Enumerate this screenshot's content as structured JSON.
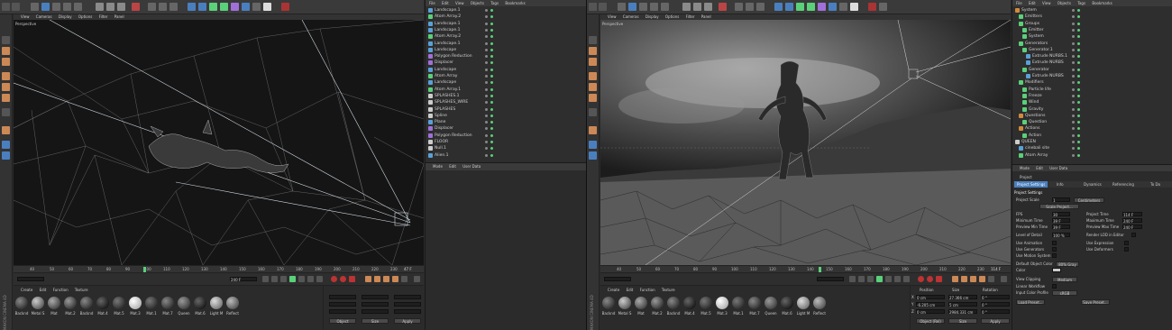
{
  "left": {
    "viewport_menu": [
      "View",
      "Cameras",
      "Display",
      "Options",
      "Filter",
      "Panel"
    ],
    "viewport_label": "Perspective",
    "timeline_ticks": [
      "40",
      "50",
      "60",
      "70",
      "80",
      "90",
      "100",
      "110",
      "120",
      "130",
      "140",
      "150",
      "160",
      "170",
      "180",
      "190",
      "200",
      "210",
      "220",
      "230"
    ],
    "frame_display": "47 F",
    "end_frame": "240 F",
    "mat_menu": [
      "Create",
      "Edit",
      "Function",
      "Texture"
    ],
    "materials": [
      "Backnd",
      "Metal S",
      "Mat",
      "Mat.2",
      "Backnd",
      "Mat.4",
      "Mat.5",
      "Mat.3",
      "Mat.1",
      "Mat.7",
      "Queen",
      "Mat.6",
      "Light M",
      "Reflect"
    ],
    "coord_buttons": [
      "Object",
      "Size",
      "Apply"
    ],
    "objects": [
      {
        "name": "Landscape.1",
        "color": "#5aa0d8"
      },
      {
        "name": "Atom Array.2",
        "color": "#5ad07a"
      },
      {
        "name": "Landscape.1",
        "color": "#5aa0d8"
      },
      {
        "name": "Landscape.1",
        "color": "#5aa0d8"
      },
      {
        "name": "Atom Array.2",
        "color": "#5ad07a"
      },
      {
        "name": "Landscape.1",
        "color": "#5aa0d8"
      },
      {
        "name": "Landscape",
        "color": "#5aa0d8"
      },
      {
        "name": "Polygon Reduction",
        "color": "#a070d8"
      },
      {
        "name": "Displacer",
        "color": "#a070d8"
      },
      {
        "name": "Landscape",
        "color": "#5aa0d8"
      },
      {
        "name": "Atom Array",
        "color": "#5ad07a"
      },
      {
        "name": "Landscape",
        "color": "#5aa0d8"
      },
      {
        "name": "Atom Array.1",
        "color": "#5ad07a"
      },
      {
        "name": "SPLASHES.1",
        "color": "#cccccc"
      },
      {
        "name": "SPLASHES_WIRE",
        "color": "#cccccc"
      },
      {
        "name": "SPLASHES",
        "color": "#cccccc"
      },
      {
        "name": "Spline",
        "color": "#cccccc"
      },
      {
        "name": "Plane",
        "color": "#5aa0d8"
      },
      {
        "name": "Displacer",
        "color": "#a070d8"
      },
      {
        "name": "Polygon Reduction",
        "color": "#a070d8"
      },
      {
        "name": "FLOOR",
        "color": "#cccccc"
      },
      {
        "name": "Null.1",
        "color": "#cccccc"
      },
      {
        "name": "Alien.1",
        "color": "#5aa0d8"
      }
    ],
    "om_menu": [
      "File",
      "Edit",
      "View",
      "Objects",
      "Tags",
      "Bookmarks"
    ],
    "attr_menu": [
      "Mode",
      "Edit",
      "User Data"
    ]
  },
  "right": {
    "viewport_menu": [
      "View",
      "Cameras",
      "Display",
      "Options",
      "Filter",
      "Panel"
    ],
    "viewport_label": "Perspective",
    "timeline_ticks": [
      "40",
      "50",
      "60",
      "70",
      "80",
      "90",
      "100",
      "110",
      "120",
      "130",
      "140",
      "150",
      "160",
      "170",
      "180",
      "190",
      "200",
      "210",
      "220",
      "230"
    ],
    "frame_display": "114 F",
    "mat_menu": [
      "Create",
      "Edit",
      "Function",
      "Texture"
    ],
    "materials": [
      "Backnd",
      "Metal S",
      "Mat",
      "Mat.2",
      "Backnd",
      "Mat.4",
      "Mat.5",
      "Mat.3",
      "Mat.1",
      "Mat.7",
      "Queen",
      "Mat.6",
      "Light M",
      "Reflect"
    ],
    "coord_headers": [
      "Position",
      "Size",
      "Rotation"
    ],
    "coords": [
      {
        "axis": "X",
        "pos": "0 cm",
        "size": "27.366 cm",
        "rot": "0 °"
      },
      {
        "axis": "Y",
        "pos": "-6.205 cm",
        "size": "5 cm",
        "rot": "0 °"
      },
      {
        "axis": "Z",
        "pos": "0 cm",
        "size": "2984.331 cm",
        "rot": "0 °"
      }
    ],
    "coord_buttons": [
      "Object (Rel)",
      "Size",
      "Apply"
    ],
    "om_menu": [
      "File",
      "Edit",
      "View",
      "Objects",
      "Tags",
      "Bookmarks"
    ],
    "objects": [
      {
        "name": "System",
        "color": "#d08a3a",
        "indent": 0
      },
      {
        "name": "Emitters",
        "color": "#5ad07a",
        "indent": 1
      },
      {
        "name": "Groups",
        "color": "#5ad07a",
        "indent": 1
      },
      {
        "name": "Emitter",
        "color": "#5ad07a",
        "indent": 2
      },
      {
        "name": "System",
        "color": "#5ad07a",
        "indent": 2
      },
      {
        "name": "Generators",
        "color": "#5ad07a",
        "indent": 1
      },
      {
        "name": "Generator.1",
        "color": "#5ad07a",
        "indent": 2
      },
      {
        "name": "Extrude NURBS.1",
        "color": "#5aa0d8",
        "indent": 3
      },
      {
        "name": "Extrude NURBS",
        "color": "#5aa0d8",
        "indent": 3
      },
      {
        "name": "Generator",
        "color": "#5ad07a",
        "indent": 2
      },
      {
        "name": "Extrude NURBS",
        "color": "#5aa0d8",
        "indent": 3
      },
      {
        "name": "Modifiers",
        "color": "#5ad07a",
        "indent": 1
      },
      {
        "name": "Particle life",
        "color": "#5ad07a",
        "indent": 2
      },
      {
        "name": "Freeze",
        "color": "#5ad07a",
        "indent": 2
      },
      {
        "name": "Wind",
        "color": "#5ad07a",
        "indent": 2
      },
      {
        "name": "Gravity",
        "color": "#5ad07a",
        "indent": 2
      },
      {
        "name": "Questions",
        "color": "#d08a3a",
        "indent": 1
      },
      {
        "name": "Question",
        "color": "#5ad07a",
        "indent": 2
      },
      {
        "name": "Actions",
        "color": "#d08a3a",
        "indent": 1
      },
      {
        "name": "Action",
        "color": "#5ad07a",
        "indent": 2
      },
      {
        "name": "QUEEN",
        "color": "#cccccc",
        "indent": 0
      },
      {
        "name": "cinebali site",
        "color": "#5aa0d8",
        "indent": 1
      },
      {
        "name": "Atom Array",
        "color": "#5ad07a",
        "indent": 1
      }
    ],
    "attr_menu": [
      "Mode",
      "Edit",
      "User Data"
    ],
    "attr_title": "Project",
    "attr_tabs": [
      "Project Settings",
      "Info",
      "Dynamics",
      "Referencing",
      "To Do"
    ],
    "section_title": "Project Settings",
    "project_scale_label": "Project Scale",
    "project_scale_value": "1",
    "project_scale_unit": "Centimeters",
    "scale_button": "Scale Project...",
    "fps_label": "FPS",
    "fps_value": "30",
    "project_time_label": "Project Time",
    "project_time_value": "114 F",
    "min_time_label": "Minimum Time",
    "min_time_value": "39 F",
    "max_time_label": "Maximum Time",
    "max_time_value": "240 F",
    "prev_min_label": "Preview Min Time",
    "prev_min_value": "39 F",
    "prev_max_label": "Preview Max Time",
    "prev_max_value": "240 F",
    "lod_label": "Level of Detail",
    "lod_value": "100 %",
    "render_lod_label": "Render LOD in Editor",
    "checks_left": [
      "Use Animation",
      "Use Generators",
      "Use Motion System"
    ],
    "checks_right": [
      "Use Expression",
      "Use Deformers"
    ],
    "default_color_label": "Default Object Color",
    "default_color_value": "80% Gray",
    "color_label": "Color",
    "clipping_label": "View Clipping",
    "clipping_value": "Medium",
    "linear_label": "Linear Workflow",
    "input_profile_label": "Input Color Profile",
    "input_profile_value": "sRGB",
    "load_preset": "Load Preset...",
    "save_preset": "Save Preset..."
  },
  "colors": {
    "accent_blue": "#4a7fbf",
    "viewport_bg": "#1a1a1a"
  }
}
